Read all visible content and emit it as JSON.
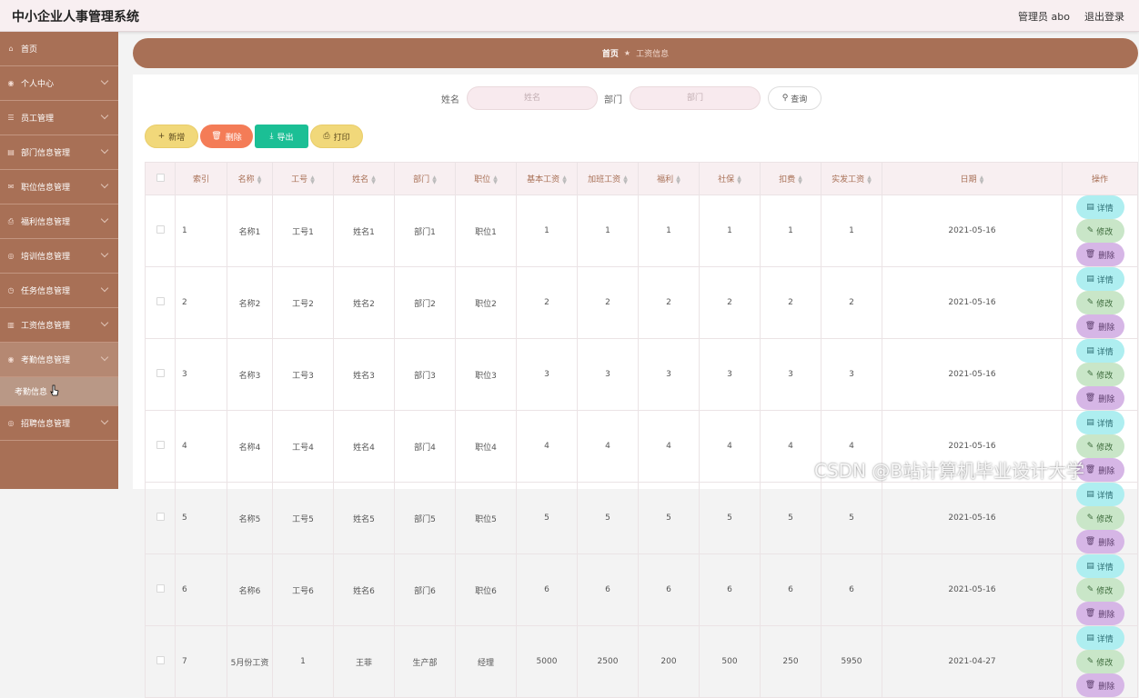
{
  "header": {
    "title": "中小企业人事管理系统",
    "user": "管理员 abo",
    "logout": "退出登录"
  },
  "sidebar": {
    "items": [
      {
        "label": "首页",
        "icon": "home-icon"
      },
      {
        "label": "个人中心",
        "icon": "user-icon"
      },
      {
        "label": "员工管理",
        "icon": "list-icon"
      },
      {
        "label": "部门信息管理",
        "icon": "doc-icon"
      },
      {
        "label": "职位信息管理",
        "icon": "mail-icon"
      },
      {
        "label": "福利信息管理",
        "icon": "printer-icon"
      },
      {
        "label": "培训信息管理",
        "icon": "circle-icon"
      },
      {
        "label": "任务信息管理",
        "icon": "clock-icon"
      },
      {
        "label": "工资信息管理",
        "icon": "bar-chart-icon"
      },
      {
        "label": "考勤信息管理",
        "icon": "user-icon"
      },
      {
        "label": "招聘信息管理",
        "icon": "circle-icon"
      }
    ],
    "sub_item": "考勤信息"
  },
  "breadcrumb": {
    "home": "首页",
    "current": "工资信息"
  },
  "search": {
    "name_label": "姓名",
    "name_placeholder": "姓名",
    "dept_label": "部门",
    "dept_placeholder": "部门",
    "button": "查询"
  },
  "actions": {
    "add": "新增",
    "delete": "删除",
    "export": "导出",
    "print": "打印"
  },
  "table": {
    "headers": [
      "索引",
      "名称",
      "工号",
      "姓名",
      "部门",
      "职位",
      "基本工资",
      "加班工资",
      "福利",
      "社保",
      "扣费",
      "实发工资",
      "日期",
      "操作"
    ],
    "row_buttons": {
      "detail": "详情",
      "edit": "修改",
      "remove": "删除"
    },
    "rows": [
      [
        "1",
        "名称1",
        "工号1",
        "姓名1",
        "部门1",
        "职位1",
        "1",
        "1",
        "1",
        "1",
        "1",
        "1",
        "2021-05-16"
      ],
      [
        "2",
        "名称2",
        "工号2",
        "姓名2",
        "部门2",
        "职位2",
        "2",
        "2",
        "2",
        "2",
        "2",
        "2",
        "2021-05-16"
      ],
      [
        "3",
        "名称3",
        "工号3",
        "姓名3",
        "部门3",
        "职位3",
        "3",
        "3",
        "3",
        "3",
        "3",
        "3",
        "2021-05-16"
      ],
      [
        "4",
        "名称4",
        "工号4",
        "姓名4",
        "部门4",
        "职位4",
        "4",
        "4",
        "4",
        "4",
        "4",
        "4",
        "2021-05-16"
      ],
      [
        "5",
        "名称5",
        "工号5",
        "姓名5",
        "部门5",
        "职位5",
        "5",
        "5",
        "5",
        "5",
        "5",
        "5",
        "2021-05-16"
      ],
      [
        "6",
        "名称6",
        "工号6",
        "姓名6",
        "部门6",
        "职位6",
        "6",
        "6",
        "6",
        "6",
        "6",
        "6",
        "2021-05-16"
      ],
      [
        "7",
        "5月份工资",
        "1",
        "王菲",
        "生产部",
        "经理",
        "5000",
        "2500",
        "200",
        "500",
        "250",
        "5950",
        "2021-04-27"
      ]
    ]
  },
  "watermark": "CSDN @B站计算机毕业设计大学",
  "colors": {
    "primary": "#a87056",
    "header_bg": "#f8eff1",
    "export": "#1bbf95",
    "delete": "#f47c57",
    "add": "#f1d87a"
  }
}
